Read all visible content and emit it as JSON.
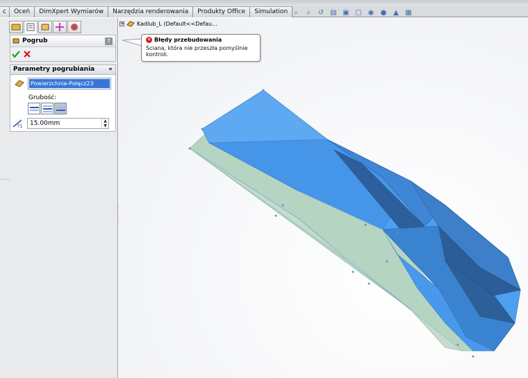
{
  "tabs": [
    {
      "label": "c"
    },
    {
      "label": "Oceń"
    },
    {
      "label": "DimXpert Wymiarów"
    },
    {
      "label": "Narzędzia renderowania"
    },
    {
      "label": "Produkty Office"
    },
    {
      "label": "Simulation"
    }
  ],
  "feature": {
    "title": "Pogrub",
    "help": "?"
  },
  "params": {
    "header": "Parametry pogrubiania",
    "selection": "Powierzchnia-Połącz23",
    "thickness_label": "Grubość:",
    "thickness_value": "15.00mm"
  },
  "tree": {
    "item": "Kadlub_L  (Default<<Defau..."
  },
  "tooltip": {
    "title": "Błędy przebudowania",
    "message": "Ściana, która nie przeszła pomyślnie kontroli."
  },
  "colors": {
    "model_blue": "#4d9ff0",
    "model_dark": "#2e5f9a",
    "model_green": "#b6d4c2",
    "accept": "#1e9c2a",
    "cancel": "#d21414",
    "selection": "#3875d7"
  }
}
